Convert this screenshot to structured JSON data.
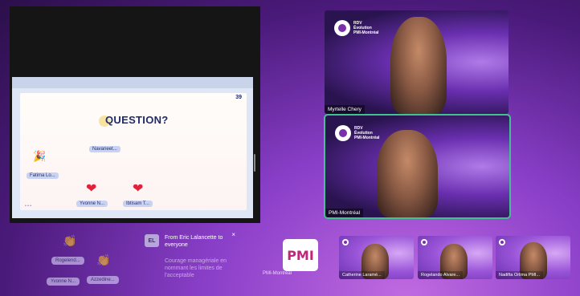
{
  "slide": {
    "page_number": "39",
    "title": "QUESTION?",
    "chips": [
      "Navaneet...",
      "Fatima Lo...",
      "Yvonne N...",
      "Ibtisam T..."
    ]
  },
  "participants": {
    "main": [
      {
        "name": "Myrtelle Chery",
        "logo_lines": [
          "RDV",
          "Évolution",
          "PMI-Montréal"
        ]
      },
      {
        "name": "PMI-Montréal",
        "logo_lines": [
          "RDV",
          "Évolution",
          "PMI-Montréal"
        ]
      }
    ],
    "strip": [
      {
        "name": "PMI-Montréal"
      },
      {
        "name": "Catherine Laramé..."
      },
      {
        "name": "Rogelando Alvare..."
      },
      {
        "name": "Nadifta Orlima PMI..."
      }
    ]
  },
  "reactions": {
    "names": [
      "Rogelend...",
      "Yvonne N...",
      "Azzedine..."
    ]
  },
  "chat": {
    "avatar_initials": "EL",
    "from": "From Eric Lalancette to everyone",
    "message": "Courage managériale en nommant les limites de l'acceptable",
    "close_label": "×"
  },
  "logo_text": "PMI",
  "colors": {
    "accent_active": "#3fc28e",
    "heart": "#e0223a",
    "background": "#4a1a7a"
  }
}
